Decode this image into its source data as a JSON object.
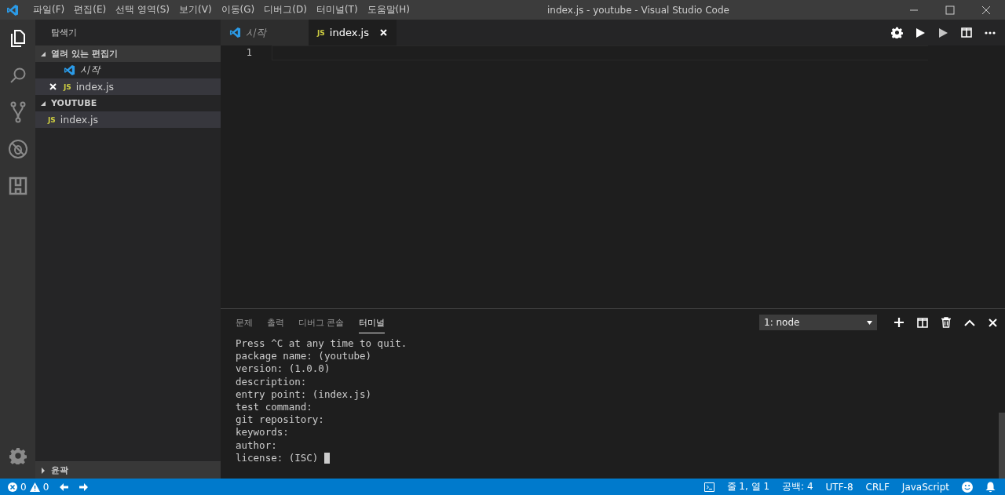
{
  "title_bar": {
    "menu": [
      "파일(F)",
      "편집(E)",
      "선택 영역(S)",
      "보기(V)",
      "이동(G)",
      "디버그(D)",
      "터미널(T)",
      "도움말(H)"
    ],
    "title": "index.js - youtube - Visual Studio Code"
  },
  "activity_bar": [
    {
      "kind": "files",
      "selected": true
    },
    {
      "kind": "search",
      "selected": false
    },
    {
      "kind": "scm",
      "selected": false
    },
    {
      "kind": "debug",
      "selected": false
    },
    {
      "kind": "extensions",
      "selected": false
    }
  ],
  "sidebar": {
    "title": "탐색기",
    "sections": [
      {
        "label": "열려 있는 편집기",
        "expanded": true,
        "items": [
          {
            "label": "시작",
            "kind": "welcome",
            "selected": false,
            "closable": false
          },
          {
            "label": "index.js",
            "kind": "js",
            "icon_text": "JS",
            "selected": true,
            "closable": true
          }
        ]
      },
      {
        "label": "YOUTUBE",
        "expanded": true,
        "items": [
          {
            "label": "index.js",
            "kind": "js",
            "icon_text": "JS",
            "selected": true
          }
        ]
      }
    ],
    "outline": {
      "label": "윤곽",
      "expanded": false
    }
  },
  "editor": {
    "tabs": [
      {
        "label": "시작",
        "kind": "welcome",
        "selected": false
      },
      {
        "label": "index.js",
        "kind": "js",
        "icon_text": "JS",
        "selected": true
      }
    ],
    "line_numbers": [
      "1"
    ]
  },
  "panel": {
    "tabs": [
      {
        "label": "문제",
        "selected": false
      },
      {
        "label": "출력",
        "selected": false
      },
      {
        "label": "디버그 콘솔",
        "selected": false
      },
      {
        "label": "터미널",
        "selected": true
      }
    ],
    "terminal_select": "1: node",
    "lines": [
      "Press ^C at any time to quit.",
      "package name: (youtube)",
      "version: (1.0.0)",
      "description:",
      "entry point: (index.js)",
      "test command:",
      "git repository:",
      "keywords:",
      "author:",
      "license: (ISC) "
    ]
  },
  "status_bar": {
    "errors": "0",
    "warnings": "0",
    "right": [
      "줄 1, 열 1",
      "공백: 4",
      "UTF-8",
      "CRLF",
      "JavaScript"
    ]
  }
}
